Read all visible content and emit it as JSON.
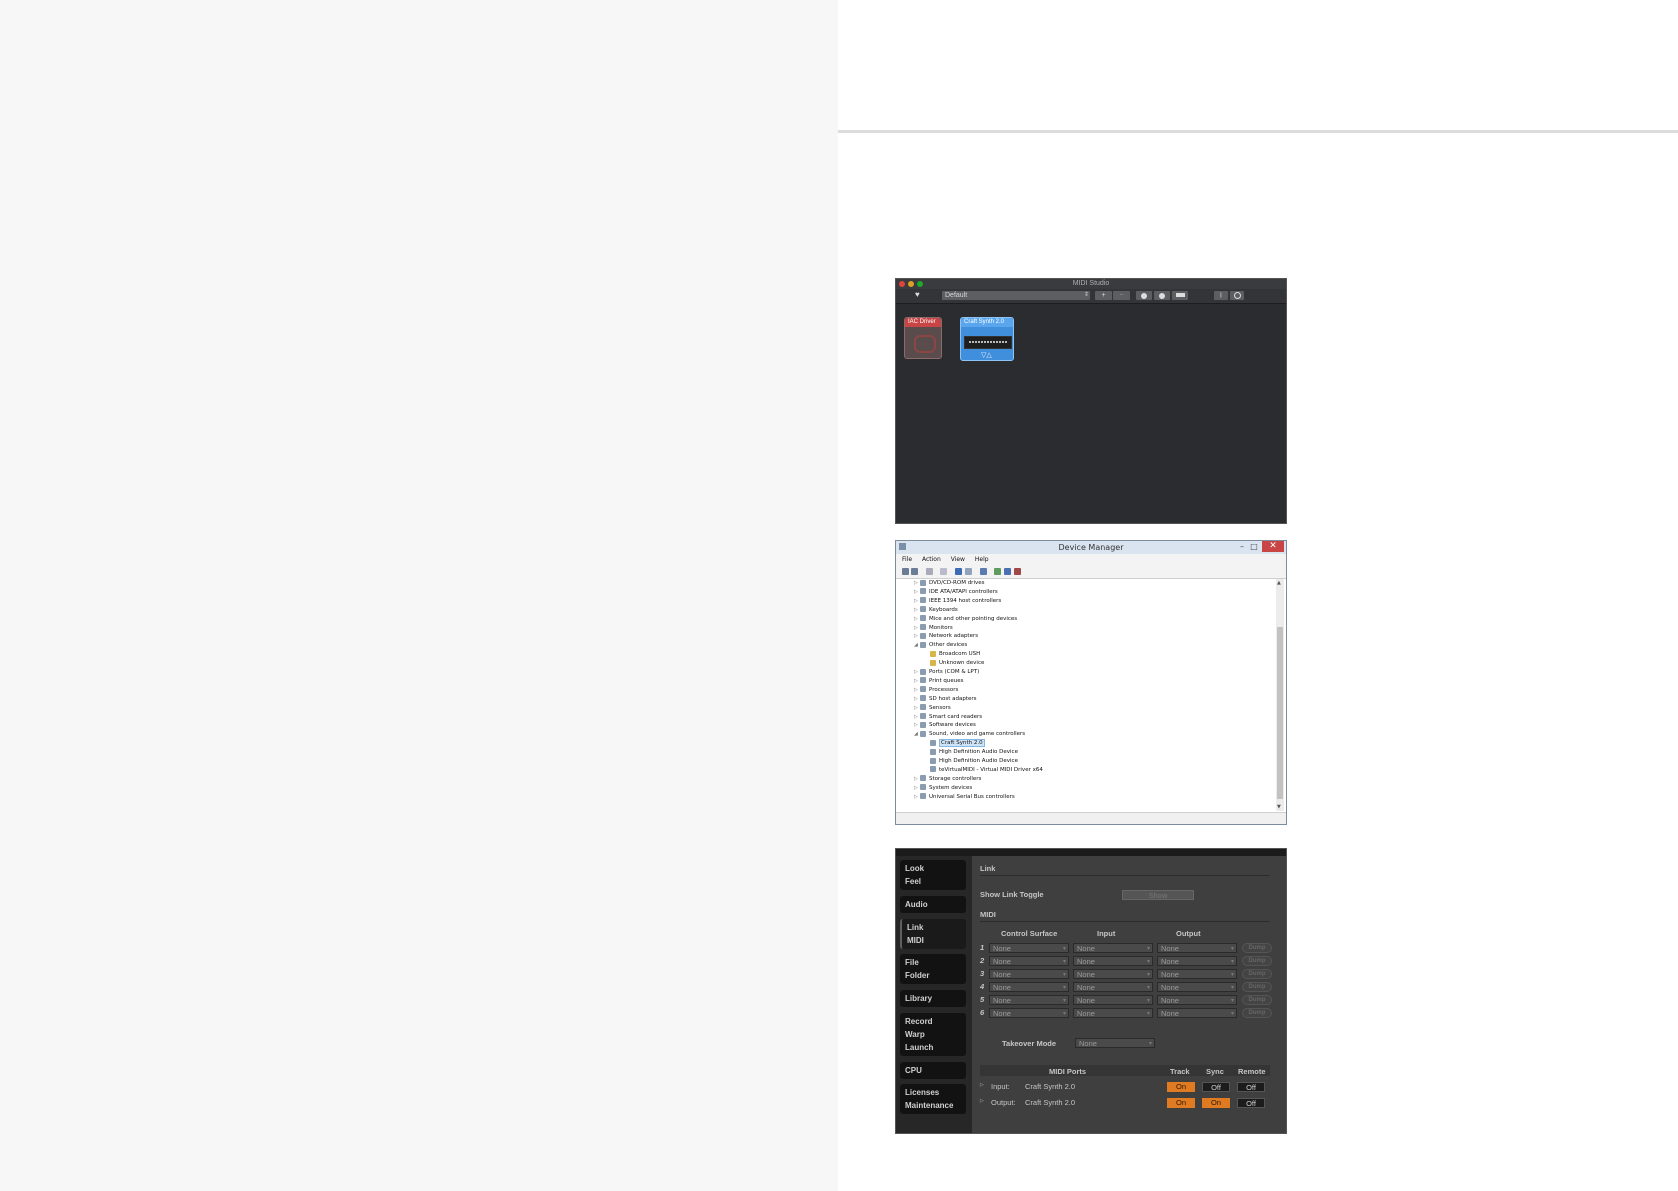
{
  "midi_studio": {
    "title": "MIDI Studio",
    "config": "Default",
    "add_label": "+",
    "remove_label": "−",
    "devices": [
      {
        "name": "IAC Driver"
      },
      {
        "name": "Craft Synth 2.0"
      }
    ],
    "colors": {
      "bg": "#2b2c2f",
      "iac": "#c94545",
      "craft": "#3f8fdd"
    }
  },
  "device_manager": {
    "title": "Device Manager",
    "menu": [
      "File",
      "Action",
      "View",
      "Help"
    ],
    "tree": [
      {
        "label": "DVD/CD-ROM drives",
        "level": 0,
        "expanded": false
      },
      {
        "label": "IDE ATA/ATAPI controllers",
        "level": 0,
        "expanded": false
      },
      {
        "label": "IEEE 1394 host controllers",
        "level": 0,
        "expanded": false
      },
      {
        "label": "Keyboards",
        "level": 0,
        "expanded": false
      },
      {
        "label": "Mice and other pointing devices",
        "level": 0,
        "expanded": false
      },
      {
        "label": "Monitors",
        "level": 0,
        "expanded": false
      },
      {
        "label": "Network adapters",
        "level": 0,
        "expanded": false
      },
      {
        "label": "Other devices",
        "level": 0,
        "expanded": true
      },
      {
        "label": "Broadcom USH",
        "level": 1
      },
      {
        "label": "Unknown device",
        "level": 1
      },
      {
        "label": "Ports (COM & LPT)",
        "level": 0,
        "expanded": false
      },
      {
        "label": "Print queues",
        "level": 0,
        "expanded": false
      },
      {
        "label": "Processors",
        "level": 0,
        "expanded": false
      },
      {
        "label": "SD host adapters",
        "level": 0,
        "expanded": false
      },
      {
        "label": "Sensors",
        "level": 0,
        "expanded": false
      },
      {
        "label": "Smart card readers",
        "level": 0,
        "expanded": false
      },
      {
        "label": "Software devices",
        "level": 0,
        "expanded": false
      },
      {
        "label": "Sound, video and game controllers",
        "level": 0,
        "expanded": true
      },
      {
        "label": "Craft Synth 2.0",
        "level": 1,
        "selected": true
      },
      {
        "label": "High Definition Audio Device",
        "level": 1
      },
      {
        "label": "High Definition Audio Device",
        "level": 1
      },
      {
        "label": "teVirtualMIDI - Virtual MIDI Driver x64",
        "level": 1
      },
      {
        "label": "Storage controllers",
        "level": 0,
        "expanded": false
      },
      {
        "label": "System devices",
        "level": 0,
        "expanded": false
      },
      {
        "label": "Universal Serial Bus controllers",
        "level": 0,
        "expanded": false
      }
    ]
  },
  "ableton_prefs": {
    "tabs": [
      [
        "Look",
        "Feel"
      ],
      [
        "Audio"
      ],
      [
        "Link",
        "MIDI"
      ],
      [
        "File",
        "Folder"
      ],
      [
        "Library"
      ],
      [
        "Record",
        "Warp",
        "Launch"
      ],
      [
        "CPU"
      ],
      [
        "Licenses",
        "Maintenance"
      ]
    ],
    "link_heading": "Link",
    "show_link_toggle_label": "Show Link Toggle",
    "show_link_toggle_value": "Show",
    "midi_heading": "MIDI",
    "col_control_surface": "Control Surface",
    "col_input": "Input",
    "col_output": "Output",
    "surfaces": [
      {
        "num": "1",
        "control": "None",
        "input": "None",
        "output": "None",
        "dump": "Dump"
      },
      {
        "num": "2",
        "control": "None",
        "input": "None",
        "output": "None",
        "dump": "Dump"
      },
      {
        "num": "3",
        "control": "None",
        "input": "None",
        "output": "None",
        "dump": "Dump"
      },
      {
        "num": "4",
        "control": "None",
        "input": "None",
        "output": "None",
        "dump": "Dump"
      },
      {
        "num": "5",
        "control": "None",
        "input": "None",
        "output": "None",
        "dump": "Dump"
      },
      {
        "num": "6",
        "control": "None",
        "input": "None",
        "output": "None",
        "dump": "Dump"
      }
    ],
    "takeover_label": "Takeover Mode",
    "takeover_value": "None",
    "ports_heading": "MIDI Ports",
    "col_track": "Track",
    "col_sync": "Sync",
    "col_remote": "Remote",
    "ports": [
      {
        "dir": "Input:",
        "name": "Craft Synth 2.0",
        "track": "On",
        "sync": "Off",
        "remote": "Off"
      },
      {
        "dir": "Output:",
        "name": "Craft Synth 2.0",
        "track": "On",
        "sync": "On",
        "remote": "Off"
      }
    ],
    "colors": {
      "on": "#e07b22",
      "bg": "#3f3f3f"
    }
  }
}
